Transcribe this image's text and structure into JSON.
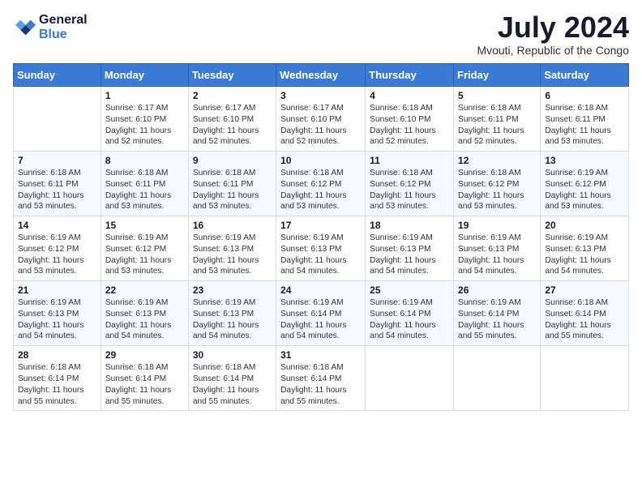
{
  "header": {
    "logo_general": "General",
    "logo_blue": "Blue",
    "month_year": "July 2024",
    "location": "Mvouti, Republic of the Congo"
  },
  "weekdays": [
    "Sunday",
    "Monday",
    "Tuesday",
    "Wednesday",
    "Thursday",
    "Friday",
    "Saturday"
  ],
  "weeks": [
    [
      {
        "day": "",
        "text": ""
      },
      {
        "day": "1",
        "text": "Sunrise: 6:17 AM\nSunset: 6:10 PM\nDaylight: 11 hours\nand 52 minutes."
      },
      {
        "day": "2",
        "text": "Sunrise: 6:17 AM\nSunset: 6:10 PM\nDaylight: 11 hours\nand 52 minutes."
      },
      {
        "day": "3",
        "text": "Sunrise: 6:17 AM\nSunset: 6:10 PM\nDaylight: 11 hours\nand 52 minutes."
      },
      {
        "day": "4",
        "text": "Sunrise: 6:18 AM\nSunset: 6:10 PM\nDaylight: 11 hours\nand 52 minutes."
      },
      {
        "day": "5",
        "text": "Sunrise: 6:18 AM\nSunset: 6:11 PM\nDaylight: 11 hours\nand 52 minutes."
      },
      {
        "day": "6",
        "text": "Sunrise: 6:18 AM\nSunset: 6:11 PM\nDaylight: 11 hours\nand 53 minutes."
      }
    ],
    [
      {
        "day": "7",
        "text": "Sunrise: 6:18 AM\nSunset: 6:11 PM\nDaylight: 11 hours\nand 53 minutes."
      },
      {
        "day": "8",
        "text": "Sunrise: 6:18 AM\nSunset: 6:11 PM\nDaylight: 11 hours\nand 53 minutes."
      },
      {
        "day": "9",
        "text": "Sunrise: 6:18 AM\nSunset: 6:11 PM\nDaylight: 11 hours\nand 53 minutes."
      },
      {
        "day": "10",
        "text": "Sunrise: 6:18 AM\nSunset: 6:12 PM\nDaylight: 11 hours\nand 53 minutes."
      },
      {
        "day": "11",
        "text": "Sunrise: 6:18 AM\nSunset: 6:12 PM\nDaylight: 11 hours\nand 53 minutes."
      },
      {
        "day": "12",
        "text": "Sunrise: 6:18 AM\nSunset: 6:12 PM\nDaylight: 11 hours\nand 53 minutes."
      },
      {
        "day": "13",
        "text": "Sunrise: 6:19 AM\nSunset: 6:12 PM\nDaylight: 11 hours\nand 53 minutes."
      }
    ],
    [
      {
        "day": "14",
        "text": "Sunrise: 6:19 AM\nSunset: 6:12 PM\nDaylight: 11 hours\nand 53 minutes."
      },
      {
        "day": "15",
        "text": "Sunrise: 6:19 AM\nSunset: 6:12 PM\nDaylight: 11 hours\nand 53 minutes."
      },
      {
        "day": "16",
        "text": "Sunrise: 6:19 AM\nSunset: 6:13 PM\nDaylight: 11 hours\nand 53 minutes."
      },
      {
        "day": "17",
        "text": "Sunrise: 6:19 AM\nSunset: 6:13 PM\nDaylight: 11 hours\nand 54 minutes."
      },
      {
        "day": "18",
        "text": "Sunrise: 6:19 AM\nSunset: 6:13 PM\nDaylight: 11 hours\nand 54 minutes."
      },
      {
        "day": "19",
        "text": "Sunrise: 6:19 AM\nSunset: 6:13 PM\nDaylight: 11 hours\nand 54 minutes."
      },
      {
        "day": "20",
        "text": "Sunrise: 6:19 AM\nSunset: 6:13 PM\nDaylight: 11 hours\nand 54 minutes."
      }
    ],
    [
      {
        "day": "21",
        "text": "Sunrise: 6:19 AM\nSunset: 6:13 PM\nDaylight: 11 hours\nand 54 minutes."
      },
      {
        "day": "22",
        "text": "Sunrise: 6:19 AM\nSunset: 6:13 PM\nDaylight: 11 hours\nand 54 minutes."
      },
      {
        "day": "23",
        "text": "Sunrise: 6:19 AM\nSunset: 6:13 PM\nDaylight: 11 hours\nand 54 minutes."
      },
      {
        "day": "24",
        "text": "Sunrise: 6:19 AM\nSunset: 6:14 PM\nDaylight: 11 hours\nand 54 minutes."
      },
      {
        "day": "25",
        "text": "Sunrise: 6:19 AM\nSunset: 6:14 PM\nDaylight: 11 hours\nand 54 minutes."
      },
      {
        "day": "26",
        "text": "Sunrise: 6:19 AM\nSunset: 6:14 PM\nDaylight: 11 hours\nand 55 minutes."
      },
      {
        "day": "27",
        "text": "Sunrise: 6:18 AM\nSunset: 6:14 PM\nDaylight: 11 hours\nand 55 minutes."
      }
    ],
    [
      {
        "day": "28",
        "text": "Sunrise: 6:18 AM\nSunset: 6:14 PM\nDaylight: 11 hours\nand 55 minutes."
      },
      {
        "day": "29",
        "text": "Sunrise: 6:18 AM\nSunset: 6:14 PM\nDaylight: 11 hours\nand 55 minutes."
      },
      {
        "day": "30",
        "text": "Sunrise: 6:18 AM\nSunset: 6:14 PM\nDaylight: 11 hours\nand 55 minutes."
      },
      {
        "day": "31",
        "text": "Sunrise: 6:18 AM\nSunset: 6:14 PM\nDaylight: 11 hours\nand 55 minutes."
      },
      {
        "day": "",
        "text": ""
      },
      {
        "day": "",
        "text": ""
      },
      {
        "day": "",
        "text": ""
      }
    ]
  ]
}
